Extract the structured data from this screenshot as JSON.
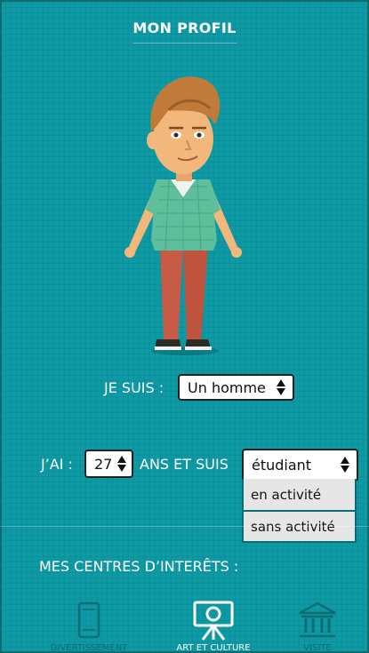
{
  "header": {
    "title": "MON PROFIL"
  },
  "profile": {
    "gender_label": "JE SUIS :",
    "gender_value": "Un homme",
    "age_label": "J’AI :",
    "age_value": "27",
    "status_label": "ANS ET SUIS",
    "status_value": "étudiant",
    "status_options": [
      "en activité",
      "sans activité"
    ]
  },
  "interests": {
    "title": "MES CENTRES D’INTERÊTS :",
    "categories": [
      {
        "label": "DIVERTISSEMENT",
        "icon": "phone-icon"
      },
      {
        "label": "ART ET CULTURE",
        "icon": "projector-icon"
      },
      {
        "label": "VISITE",
        "icon": "museum-icon"
      }
    ]
  },
  "colors": {
    "background": "#0e9aa4",
    "shirt": "#5fbf9c",
    "pants": "#c75b45",
    "hair": "#c07a3a"
  }
}
